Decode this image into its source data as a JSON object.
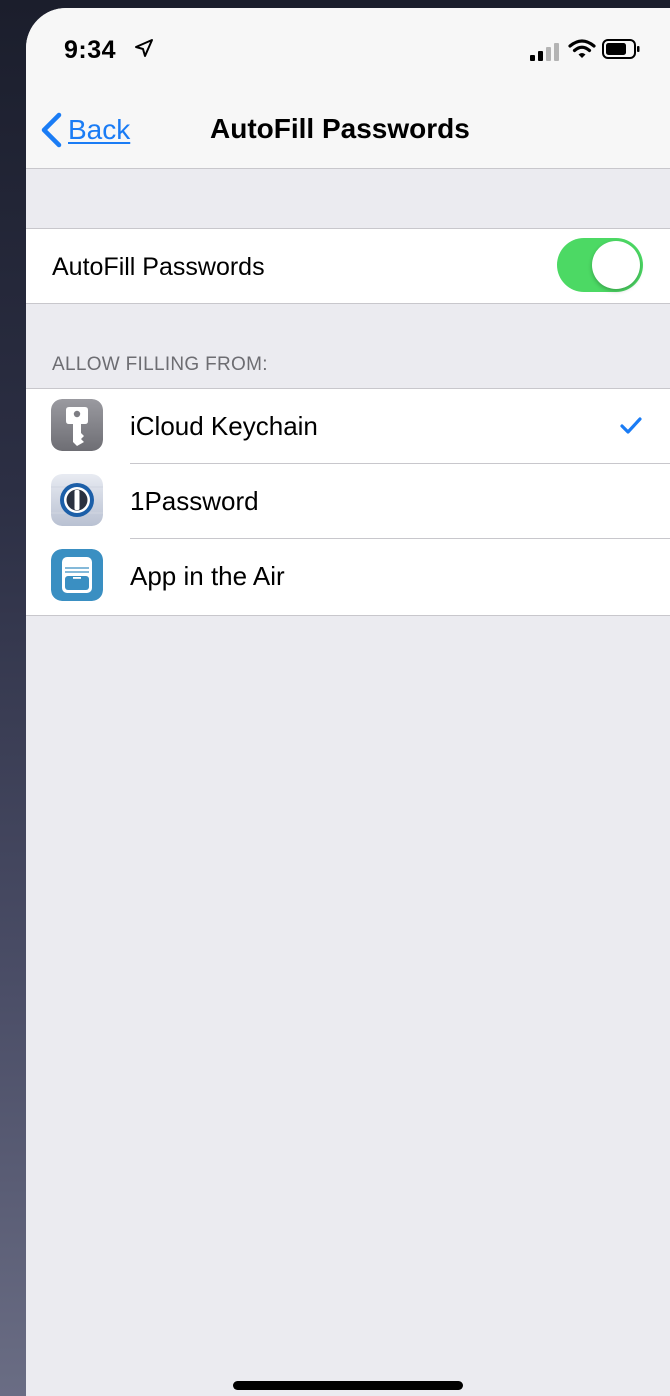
{
  "status_bar": {
    "time": "9:34",
    "location_icon": "location-arrow-icon",
    "signal_icon": "cellular-signal-icon",
    "wifi_icon": "wifi-icon",
    "battery_icon": "battery-icon"
  },
  "nav": {
    "back_label": "Back",
    "back_icon": "chevron-left-icon",
    "title": "AutoFill Passwords"
  },
  "autofill_toggle": {
    "label": "AutoFill Passwords",
    "enabled": true
  },
  "allow_filling": {
    "header": "ALLOW FILLING FROM:",
    "items": [
      {
        "label": "iCloud Keychain",
        "icon": "keychain-icon",
        "selected": true
      },
      {
        "label": "1Password",
        "icon": "1password-icon",
        "selected": false
      },
      {
        "label": "App in the Air",
        "icon": "app-in-the-air-icon",
        "selected": false
      }
    ]
  },
  "colors": {
    "accent": "#1a7cf5",
    "toggle_on": "#4cd964",
    "background": "#ebebf0",
    "header_text": "#6d6d72",
    "separator": "#c8c7cc"
  }
}
